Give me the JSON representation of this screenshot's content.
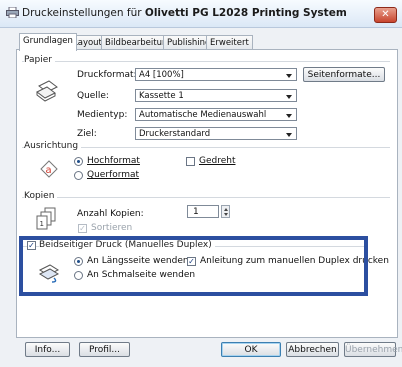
{
  "window": {
    "title_prefix": "Druckeinstellungen für ",
    "title_printer": "Olivetti PG L2028 Printing System",
    "close_glyph": "✕"
  },
  "tabs": [
    "Grundlagen",
    "Layout",
    "Bildbearbeitung",
    "Publishing",
    "Erweitert"
  ],
  "paper": {
    "group": "Papier",
    "format_label": "Druckformat:",
    "format_value": "A4  [100%]",
    "page_formats_button": "Seitenformate...",
    "source_label": "Quelle:",
    "source_value": "Kassette 1",
    "media_label": "Medientyp:",
    "media_value": "Automatische Medienauswahl",
    "target_label": "Ziel:",
    "target_value": "Druckerstandard"
  },
  "orientation": {
    "group": "Ausrichtung",
    "portrait": "Hochformat",
    "landscape": "Querformat",
    "rotated": "Gedreht",
    "selected": "portrait"
  },
  "copies": {
    "group": "Kopien",
    "count_label": "Anzahl Kopien:",
    "count_value": "1",
    "collate": "Sortieren"
  },
  "duplex": {
    "group": "Beidseitiger Druck (Manuelles Duplex)",
    "long_edge": "An Längsseite wenden",
    "short_edge": "An Schmalseite wenden",
    "guide": "Anleitung zum manuellen Duplex drucken",
    "enabled": true,
    "guide_checked": true
  },
  "footer": {
    "info": "Info...",
    "profile": "Profil...",
    "ok": "OK",
    "cancel": "Abbrechen",
    "apply": "Übernehmen"
  },
  "colors": {
    "highlight_border": "#2c4fa0",
    "close_button": "#c8452e"
  }
}
